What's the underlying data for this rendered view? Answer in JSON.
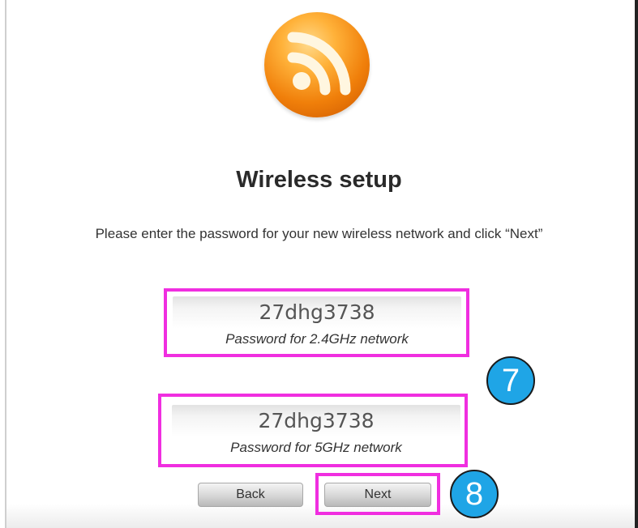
{
  "page": {
    "title": "Wireless setup",
    "instructions": "Please enter the password for your new wireless network and click “Next”"
  },
  "networks": [
    {
      "password": "27dhg3738",
      "label": "Password for 2.4GHz network"
    },
    {
      "password": "27dhg3738",
      "label": "Password for 5GHz network"
    }
  ],
  "buttons": {
    "back": "Back",
    "next": "Next"
  },
  "annotations": {
    "step_7": "7",
    "step_8": "8"
  },
  "colors": {
    "highlight": "#f02ee0",
    "badge": "#1fa5e6",
    "logo": "#f08a10"
  },
  "icons": {
    "logo": "wifi-signal-icon"
  }
}
